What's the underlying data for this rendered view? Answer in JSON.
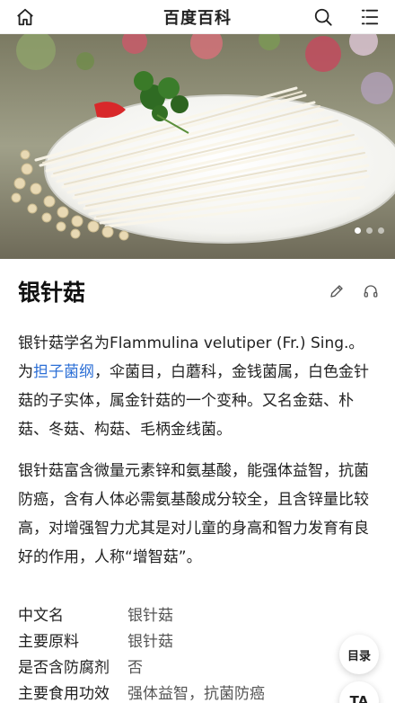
{
  "header": {
    "title": "百度百科",
    "home_icon": "home-icon",
    "search_icon": "search-icon",
    "menu_icon": "menu-icon"
  },
  "carousel": {
    "image_subject": "enoki-mushrooms-plate",
    "slide_count": 3,
    "active_slide": 1
  },
  "entry": {
    "title": "银针菇",
    "edit_icon": "pencil-icon",
    "audio_icon": "headphones-icon"
  },
  "summary": {
    "p1_before_link": "银针菇学名为Flammulina velutiper (Fr.) Sing.。为",
    "p1_link": "担子菌纲",
    "p1_after_link": "，伞菌目，白蘑科，金钱菌属，白色金针菇的子实体，属金针菇的一个变种。又名金菇、朴菇、冬菇、构菇、毛柄金线菌。",
    "p2": "银针菇富含微量元素锌和氨基酸，能强体益智，抗菌防癌，含有人体必需氨基酸成分较全，且含锌量比较高，对增强智力尤其是对儿童的身高和智力发育有良好的作用，人称“增智菇”。"
  },
  "basic_info": [
    {
      "key": "中文名",
      "value": "银针菇"
    },
    {
      "key": "主要原料",
      "value": "银针菇"
    },
    {
      "key": "是否含防腐剂",
      "value": "否"
    },
    {
      "key": "主要食用功效",
      "value": "强体益智，抗菌防癌"
    }
  ],
  "floating": {
    "toc_label": "目录",
    "ta_label": "TA"
  },
  "colors": {
    "link": "#2c6fd6",
    "text": "#222222"
  }
}
